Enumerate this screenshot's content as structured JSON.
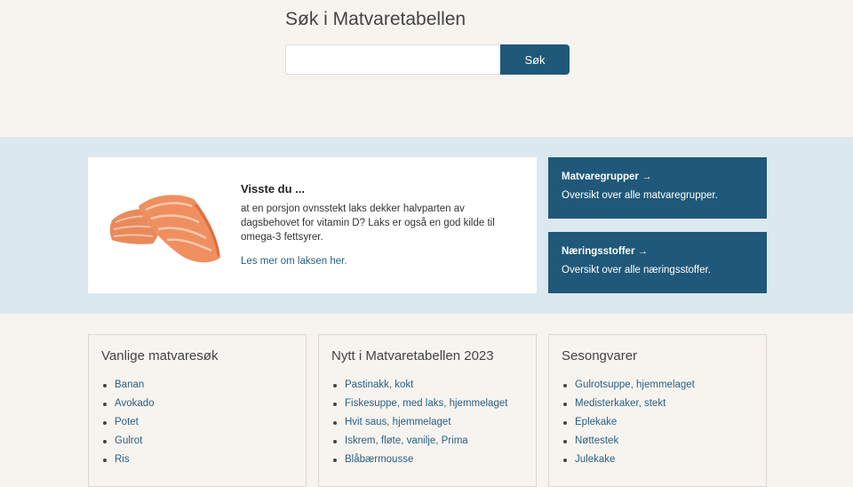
{
  "search": {
    "title": "Søk i Matvaretabellen",
    "input_value": "",
    "button_label": "Søk"
  },
  "fact": {
    "heading": "Visste du ...",
    "text": "at en porsjon ovnsstekt laks dekker halvparten av dagsbehovet for vitamin D? Laks er også en god kilde til omega-3 fettsyrer.",
    "link": "Les mer om laksen her."
  },
  "nav": [
    {
      "title": "Matvaregrupper →",
      "desc": "Oversikt over alle matvaregrupper."
    },
    {
      "title": "Næringsstoffer →",
      "desc": "Oversikt over alle næringsstoffer."
    }
  ],
  "lists": [
    {
      "title": "Vanlige matvaresøk",
      "items": [
        "Banan",
        "Avokado",
        "Potet",
        "Gulrot",
        "Ris"
      ]
    },
    {
      "title": "Nytt i Matvaretabellen 2023",
      "items": [
        "Pastinakk, kokt",
        "Fiskesuppe, med laks, hjemmelaget",
        "Hvit saus, hjemmelaget",
        "Iskrem, fløte, vanilje, Prima",
        "Blåbærmousse"
      ]
    },
    {
      "title": "Sesongvarer",
      "items": [
        "Gulrotsuppe, hjemmelaget",
        "Medisterkaker, stekt",
        "Eplekake",
        "Nøttestek",
        "Julekake"
      ]
    }
  ],
  "colors": {
    "page_background": "#f7f4f0",
    "band_background": "#dce8ef",
    "accent": "#1f5878",
    "link": "#2a5f80"
  }
}
